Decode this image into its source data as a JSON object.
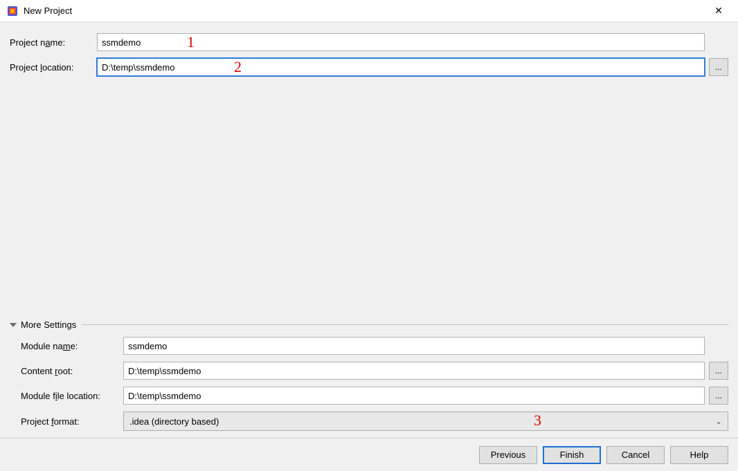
{
  "window": {
    "title": "New Project",
    "close_glyph": "✕"
  },
  "form": {
    "project_name_label_pre": "Project n",
    "project_name_label_u": "a",
    "project_name_label_post": "me:",
    "project_name_value": "ssmdemo",
    "project_location_label_pre": "Project ",
    "project_location_label_u": "l",
    "project_location_label_post": "ocation:",
    "project_location_value": "D:\\temp\\ssmdemo",
    "browse_glyph": "..."
  },
  "annotations": {
    "a1": "1",
    "a2": "2",
    "a3": "3"
  },
  "more": {
    "header": "More Settings",
    "module_name_label_pre": "Module na",
    "module_name_label_u": "m",
    "module_name_label_post": "e:",
    "module_name_value": "ssmdemo",
    "content_root_label_pre": "Content ",
    "content_root_label_u": "r",
    "content_root_label_post": "oot:",
    "content_root_value": "D:\\temp\\ssmdemo",
    "module_file_label_pre": "Module f",
    "module_file_label_u": "i",
    "module_file_label_post": "le location:",
    "module_file_value": "D:\\temp\\ssmdemo",
    "project_format_label_pre": "Project ",
    "project_format_label_u": "f",
    "project_format_label_post": "ormat:",
    "project_format_value": ".idea (directory based)"
  },
  "buttons": {
    "previous": "Previous",
    "finish": "Finish",
    "cancel": "Cancel",
    "help": "Help"
  }
}
